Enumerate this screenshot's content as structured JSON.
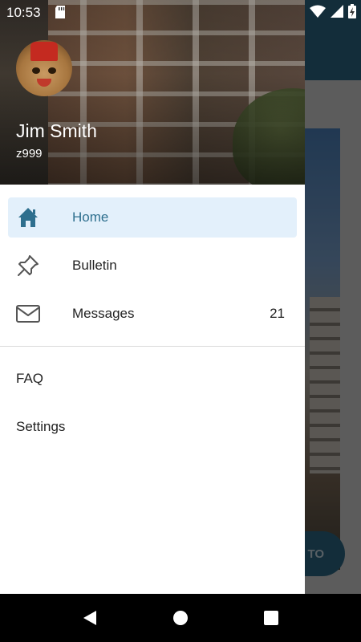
{
  "status_bar": {
    "time": "10:53",
    "icons": [
      "sd-card-icon",
      "wifi-icon",
      "cellular-icon",
      "battery-charging-icon"
    ]
  },
  "app_background": {
    "fab_label": "TO",
    "accent_color": "#2f6d8a"
  },
  "drawer": {
    "header": {
      "user_name": "Jim Smith",
      "user_id": "z999",
      "avatar_icon": "avatar-cat-icon"
    },
    "primary_items": [
      {
        "label": "Home",
        "icon": "home-icon",
        "active": true,
        "count": ""
      },
      {
        "label": "Bulletin",
        "icon": "pushpin-icon",
        "active": false,
        "count": ""
      },
      {
        "label": "Messages",
        "icon": "envelope-icon",
        "active": false,
        "count": "21"
      }
    ],
    "secondary_items": [
      {
        "label": "FAQ"
      },
      {
        "label": "Settings"
      }
    ],
    "colors": {
      "active_background": "#e3f0fb",
      "active_foreground": "#2e6f8e"
    }
  },
  "nav_bar": {
    "buttons": [
      "back-icon",
      "home-circle-icon",
      "recents-icon"
    ]
  }
}
